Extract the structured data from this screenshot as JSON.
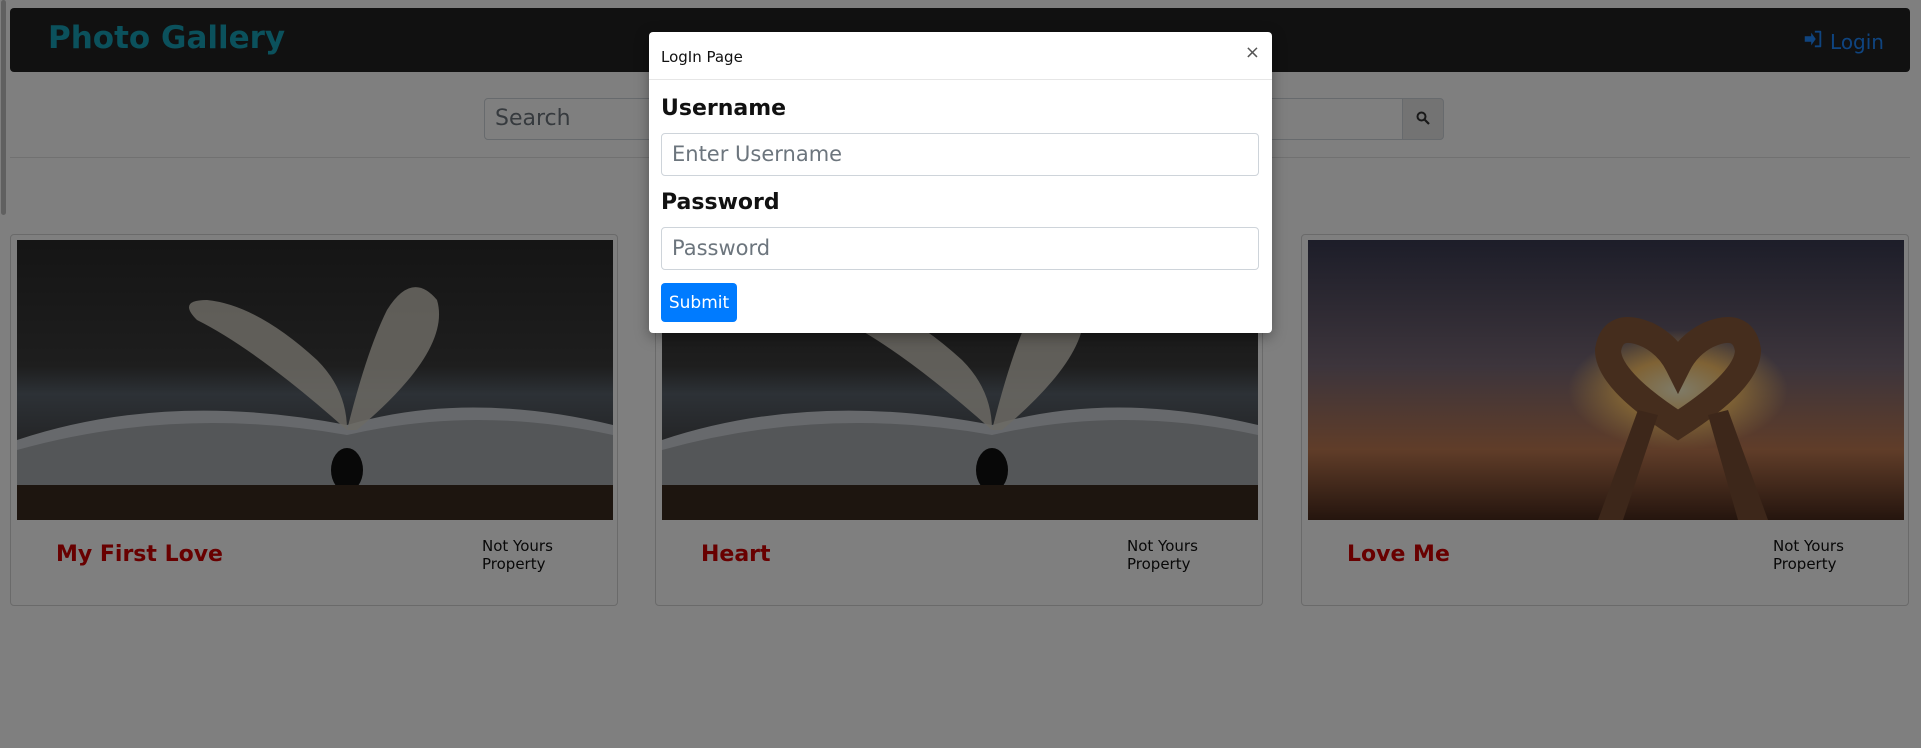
{
  "navbar": {
    "brand": "Photo Gallery",
    "login_label": "Login",
    "login_icon": "sign-in-icon"
  },
  "search": {
    "placeholder": "Search",
    "button_icon": "search-icon"
  },
  "cards": [
    {
      "title": "My First Love",
      "note": "Not Yours Property",
      "image": "book-pages-heart"
    },
    {
      "title": "Heart",
      "note": "Not Yours Property",
      "image": "book-pages-heart"
    },
    {
      "title": "Love Me",
      "note": "Not Yours Property",
      "image": "hands-heart-sunset"
    }
  ],
  "modal": {
    "title": "LogIn Page",
    "close_label": "×",
    "username_label": "Username",
    "username_placeholder": "Enter Username",
    "password_label": "Password",
    "password_placeholder": "Password",
    "submit_label": "Submit"
  },
  "colors": {
    "brand": "#17a2b8",
    "link": "#1e88ff",
    "title_red": "#d00000",
    "primary": "#007bff",
    "navbar_bg": "#222222"
  }
}
